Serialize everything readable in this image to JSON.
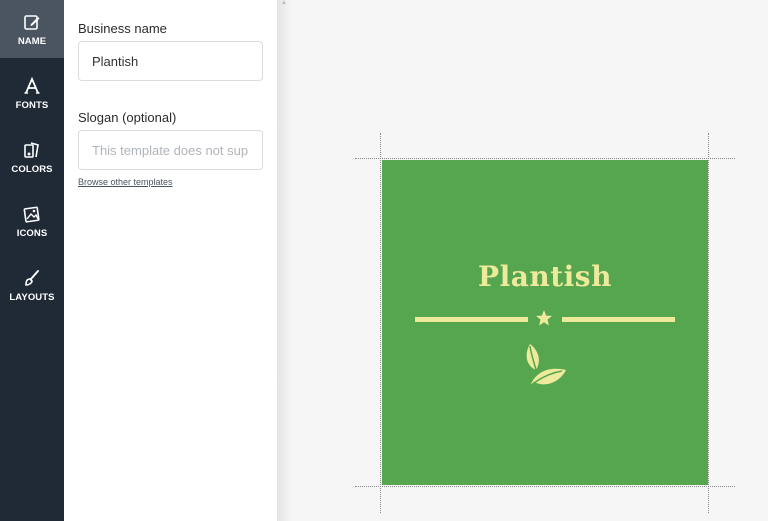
{
  "sidebar": {
    "items": [
      {
        "label": "NAME",
        "icon": "edit-icon",
        "active": true
      },
      {
        "label": "FONTS",
        "icon": "font-icon",
        "active": false
      },
      {
        "label": "COLORS",
        "icon": "palette-icon",
        "active": false
      },
      {
        "label": "ICONS",
        "icon": "image-icon",
        "active": false
      },
      {
        "label": "LAYOUTS",
        "icon": "brush-icon",
        "active": false
      }
    ]
  },
  "form": {
    "business_name_label": "Business name",
    "business_name_value": "Plantish",
    "slogan_label": "Slogan (optional)",
    "slogan_placeholder": "This template does not sup",
    "browse_link": "Browse other templates"
  },
  "logo": {
    "name": "Plantish",
    "background_color": "#56a64f",
    "accent_color": "#eeea9c",
    "divider_icon": "star-icon",
    "emblem_icon": "leaf-icon"
  }
}
